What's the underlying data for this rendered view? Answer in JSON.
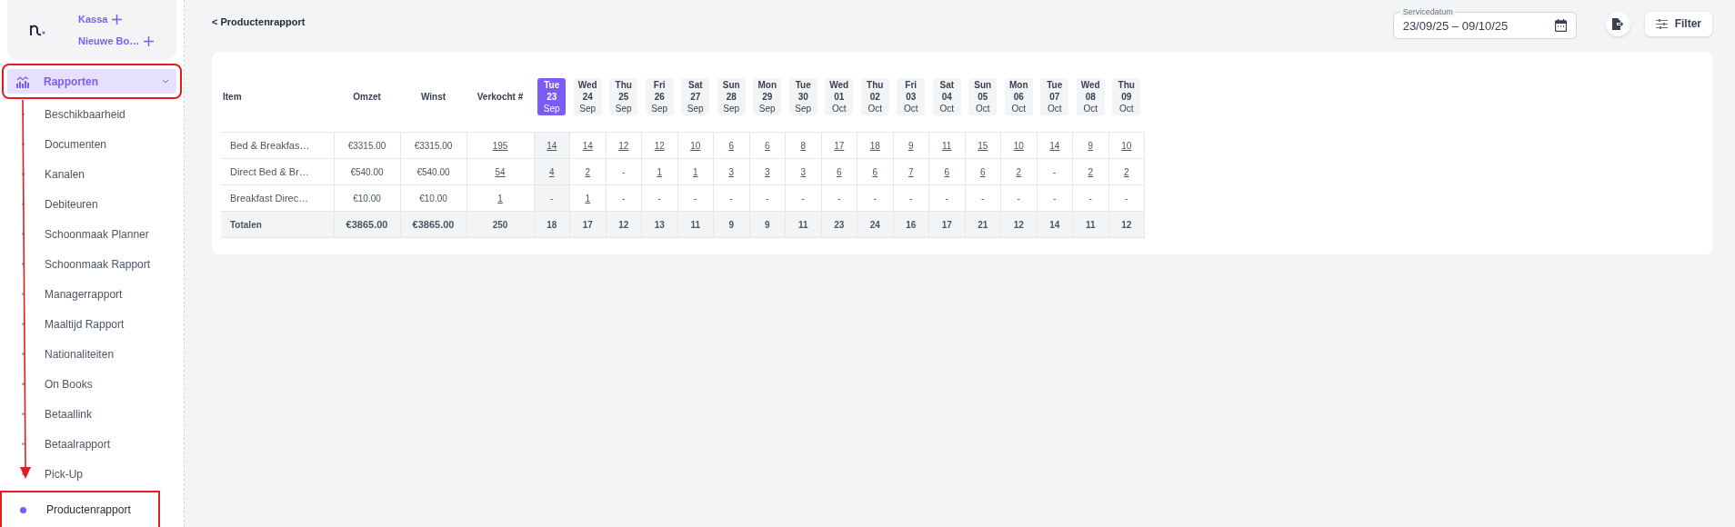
{
  "sidebar": {
    "quick_actions": [
      {
        "label": "Kassa"
      },
      {
        "label": "Nieuwe Bo…"
      }
    ],
    "menu": {
      "label": "Rapporten",
      "selected": true,
      "expanded": true,
      "highlighted": true,
      "children": [
        {
          "label": "Beschikbaarheid",
          "selected": false,
          "highlighted": false
        },
        {
          "label": "Documenten",
          "selected": false,
          "highlighted": false
        },
        {
          "label": "Kanalen",
          "selected": false,
          "highlighted": false
        },
        {
          "label": "Debiteuren",
          "selected": false,
          "highlighted": false
        },
        {
          "label": "Schoonmaak Planner",
          "selected": false,
          "highlighted": false
        },
        {
          "label": "Schoonmaak Rapport",
          "selected": false,
          "highlighted": false
        },
        {
          "label": "Managerrapport",
          "selected": false,
          "highlighted": false
        },
        {
          "label": "Maaltijd Rapport",
          "selected": false,
          "highlighted": false
        },
        {
          "label": "Nationaliteiten",
          "selected": false,
          "highlighted": false
        },
        {
          "label": "On Books",
          "selected": false,
          "highlighted": false
        },
        {
          "label": "Betaallink",
          "selected": false,
          "highlighted": false
        },
        {
          "label": "Betaalrapport",
          "selected": false,
          "highlighted": false
        },
        {
          "label": "Pick-Up",
          "selected": false,
          "highlighted": false
        },
        {
          "label": "Productenrapport",
          "selected": true,
          "highlighted": true
        }
      ]
    }
  },
  "header": {
    "back_link": "< Productenrapport",
    "date_field": {
      "label": "Servicedatum",
      "value": "23/09/25 – 09/10/25"
    },
    "filter_button": "Filter"
  },
  "table": {
    "columns": [
      "Item",
      "Omzet",
      "Winst",
      "Verkocht #"
    ],
    "days": [
      {
        "weekday": "Tue",
        "day": "23",
        "month": "Sep",
        "selected": true
      },
      {
        "weekday": "Wed",
        "day": "24",
        "month": "Sep",
        "selected": false
      },
      {
        "weekday": "Thu",
        "day": "25",
        "month": "Sep",
        "selected": false
      },
      {
        "weekday": "Fri",
        "day": "26",
        "month": "Sep",
        "selected": false
      },
      {
        "weekday": "Sat",
        "day": "27",
        "month": "Sep",
        "selected": false
      },
      {
        "weekday": "Sun",
        "day": "28",
        "month": "Sep",
        "selected": false
      },
      {
        "weekday": "Mon",
        "day": "29",
        "month": "Sep",
        "selected": false
      },
      {
        "weekday": "Tue",
        "day": "30",
        "month": "Sep",
        "selected": false
      },
      {
        "weekday": "Wed",
        "day": "01",
        "month": "Oct",
        "selected": false
      },
      {
        "weekday": "Thu",
        "day": "02",
        "month": "Oct",
        "selected": false
      },
      {
        "weekday": "Fri",
        "day": "03",
        "month": "Oct",
        "selected": false
      },
      {
        "weekday": "Sat",
        "day": "04",
        "month": "Oct",
        "selected": false
      },
      {
        "weekday": "Sun",
        "day": "05",
        "month": "Oct",
        "selected": false
      },
      {
        "weekday": "Mon",
        "day": "06",
        "month": "Oct",
        "selected": false
      },
      {
        "weekday": "Tue",
        "day": "07",
        "month": "Oct",
        "selected": false
      },
      {
        "weekday": "Wed",
        "day": "08",
        "month": "Oct",
        "selected": false
      },
      {
        "weekday": "Thu",
        "day": "09",
        "month": "Oct",
        "selected": false
      }
    ],
    "rows": [
      {
        "item": "Bed & Breakfas…",
        "omzet": "€3315.00",
        "winst": "€3315.00",
        "verkocht": "195",
        "cells": [
          {
            "text": "14",
            "link": true
          },
          {
            "text": "14",
            "link": true
          },
          {
            "text": "12",
            "link": true
          },
          {
            "text": "12",
            "link": true
          },
          {
            "text": "10",
            "link": true
          },
          {
            "text": "6",
            "link": true
          },
          {
            "text": "6",
            "link": true
          },
          {
            "text": "8",
            "link": true
          },
          {
            "text": "17",
            "link": true
          },
          {
            "text": "18",
            "link": true
          },
          {
            "text": "9",
            "link": true
          },
          {
            "text": "11",
            "link": true
          },
          {
            "text": "15",
            "link": true
          },
          {
            "text": "10",
            "link": true
          },
          {
            "text": "14",
            "link": true
          },
          {
            "text": "9",
            "link": true
          },
          {
            "text": "10",
            "link": true
          }
        ]
      },
      {
        "item": "Direct Bed & Br…",
        "omzet": "€540.00",
        "winst": "€540.00",
        "verkocht": "54",
        "cells": [
          {
            "text": "4",
            "link": true
          },
          {
            "text": "2",
            "link": true
          },
          {
            "text": "-",
            "link": false
          },
          {
            "text": "1",
            "link": true
          },
          {
            "text": "1",
            "link": true
          },
          {
            "text": "3",
            "link": true
          },
          {
            "text": "3",
            "link": true
          },
          {
            "text": "3",
            "link": true
          },
          {
            "text": "6",
            "link": true
          },
          {
            "text": "6",
            "link": true
          },
          {
            "text": "7",
            "link": true
          },
          {
            "text": "6",
            "link": true
          },
          {
            "text": "6",
            "link": true
          },
          {
            "text": "2",
            "link": true
          },
          {
            "text": "-",
            "link": false
          },
          {
            "text": "2",
            "link": true
          },
          {
            "text": "2",
            "link": true
          }
        ]
      },
      {
        "item": "Breakfast Direc…",
        "omzet": "€10.00",
        "winst": "€10.00",
        "verkocht": "1",
        "cells": [
          {
            "text": "-",
            "link": false
          },
          {
            "text": "1",
            "link": true
          },
          {
            "text": "-",
            "link": false
          },
          {
            "text": "-",
            "link": false
          },
          {
            "text": "-",
            "link": false
          },
          {
            "text": "-",
            "link": false
          },
          {
            "text": "-",
            "link": false
          },
          {
            "text": "-",
            "link": false
          },
          {
            "text": "-",
            "link": false
          },
          {
            "text": "-",
            "link": false
          },
          {
            "text": "-",
            "link": false
          },
          {
            "text": "-",
            "link": false
          },
          {
            "text": "-",
            "link": false
          },
          {
            "text": "-",
            "link": false
          },
          {
            "text": "-",
            "link": false
          },
          {
            "text": "-",
            "link": false
          },
          {
            "text": "-",
            "link": false
          }
        ]
      }
    ],
    "totals": {
      "label": "Totalen",
      "omzet": "€3865.00",
      "winst": "€3865.00",
      "verkocht": "250",
      "cells": [
        "18",
        "17",
        "12",
        "13",
        "11",
        "9",
        "9",
        "11",
        "23",
        "24",
        "16",
        "17",
        "21",
        "12",
        "14",
        "11",
        "12"
      ]
    }
  }
}
